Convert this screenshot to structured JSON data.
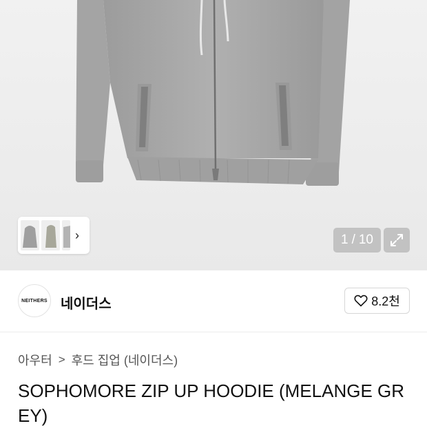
{
  "gallery": {
    "counter_current": "1",
    "counter_separator": "/",
    "counter_total": "10",
    "colors": {
      "garment": "#a8a8a8",
      "garment_shadow": "#8f8f8f",
      "rib": "#9d9d9d"
    }
  },
  "brand": {
    "logo_text": "NEITHERS",
    "name": "네이더스",
    "likes": "8.2천"
  },
  "breadcrumb": {
    "items": [
      "아우터",
      "후드 집업 (네이더스)"
    ],
    "separator": ">"
  },
  "product": {
    "title": "SOPHOMORE ZIP UP HOODIE (MELANGE GREY)"
  }
}
